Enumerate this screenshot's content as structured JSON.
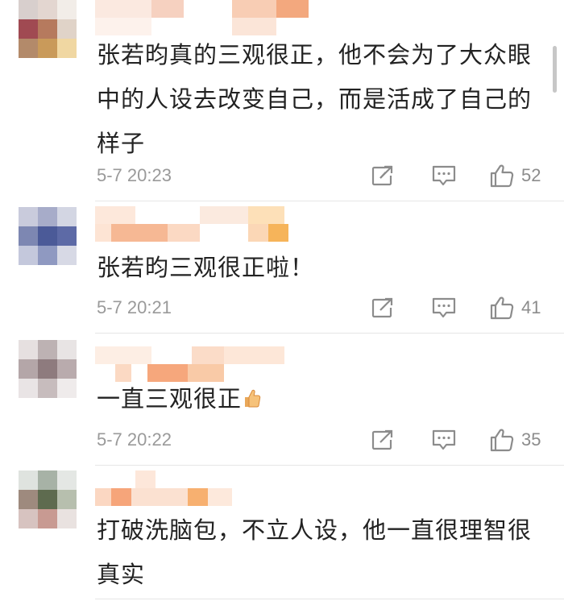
{
  "comments": [
    {
      "text": "张若昀真的三观很正，他不会为了大众眼中的人设去改变自己，而是活成了自己的样子",
      "time": "5-7 20:23",
      "likes": "52"
    },
    {
      "text": "张若昀三观很正啦！",
      "time": "5-7 20:21",
      "likes": "41"
    },
    {
      "text": "一直三观很正",
      "time": "5-7 20:22",
      "likes": "35"
    },
    {
      "text": "打破洗脑包，不立人设，他一直很理智很真实",
      "time": "",
      "likes": ""
    }
  ],
  "icons": {
    "share": "share-icon",
    "reply": "comment-icon",
    "like": "thumbs-up-icon",
    "emoji": "thumbs-up-emoji"
  },
  "colors": {
    "text": "#222222",
    "meta": "#9a9a9a",
    "divider": "#e6e6e6"
  }
}
